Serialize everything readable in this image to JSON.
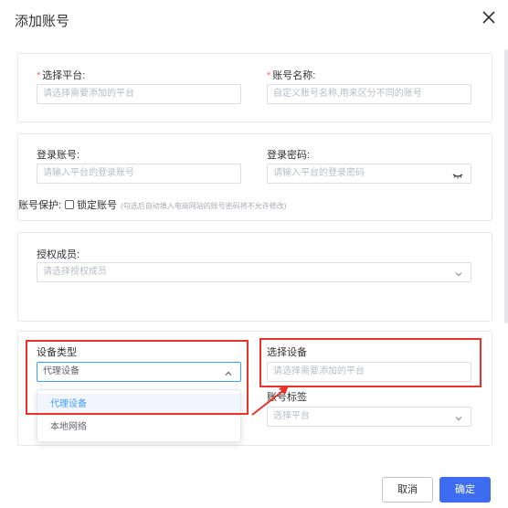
{
  "dialog": {
    "title": "添加账号",
    "close_icon": "close-icon"
  },
  "section_platform": {
    "platform_label": "选择平台:",
    "platform_placeholder": "请选择需要添加的平台",
    "account_name_label": "账号名称:",
    "account_name_placeholder": "自定义账号名称,用来区分不同的账号",
    "required_mark": "*"
  },
  "section_login": {
    "login_account_label": "登录账号:",
    "login_account_placeholder": "请输入平台的登录账号",
    "login_password_label": "登录密码:",
    "login_password_placeholder": "请输入平台的登录密码",
    "password_icon": "eye-closed-icon",
    "protect_label": "账号保护:",
    "lock_label": "锁定账号",
    "lock_hint": "(勾选后自动填入电商网站的账号密码将不允许修改)"
  },
  "section_members": {
    "members_label": "授权成员:",
    "members_placeholder": "请选择授权成员"
  },
  "section_device": {
    "device_type_label": "设备类型",
    "device_type_value": "代理设备",
    "select_device_label": "选择设备",
    "select_device_placeholder": "请选择需要添加的平台",
    "tag_label": "账号标签",
    "tag_placeholder": "选择平台",
    "options": [
      {
        "label": "代理设备",
        "selected": true
      },
      {
        "label": "本地网络",
        "selected": false
      }
    ]
  },
  "footer": {
    "cancel_label": "取消",
    "ok_label": "确定"
  },
  "colors": {
    "primary": "#3d6cf0",
    "highlight": "#e8322a",
    "required": "#f56c6c"
  }
}
